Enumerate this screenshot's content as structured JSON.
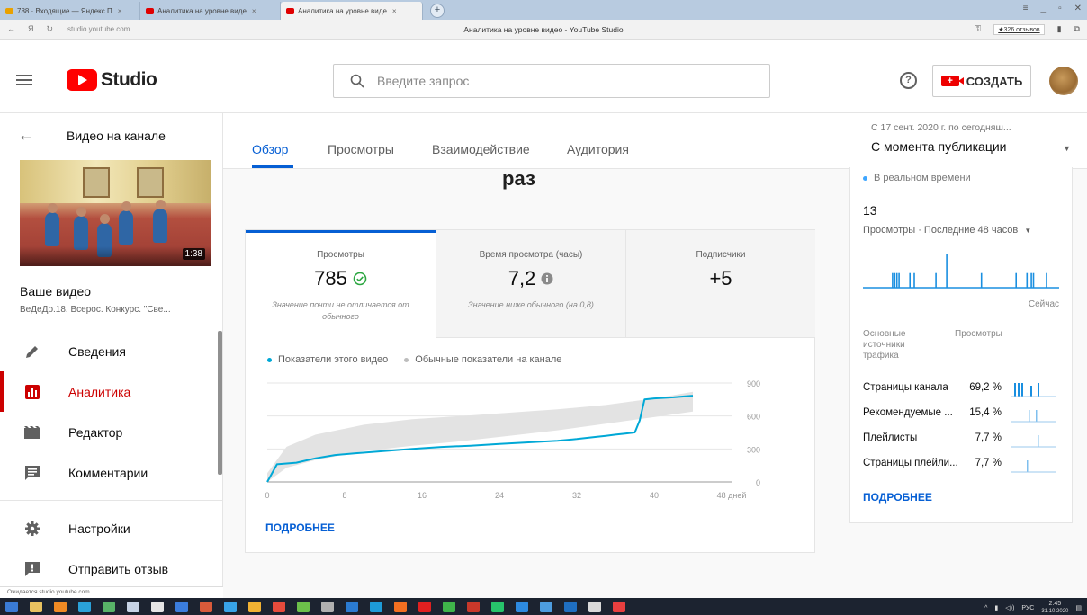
{
  "browser": {
    "tabs": [
      {
        "label": "788 · Входящие — Яндекс.П",
        "fav_color": "#e9a100"
      },
      {
        "label": "Аналитика на уровне виде",
        "fav_color": "#e00000"
      },
      {
        "label": "Аналитика на уровне виде",
        "fav_color": "#e00000"
      }
    ],
    "url": "studio.youtube.com",
    "page_title": "Аналитика на уровне видео - YouTube Studio",
    "reviews": "★326 отзывов"
  },
  "header": {
    "logo_text": "Studio",
    "search_placeholder": "Введите запрос",
    "help_glyph": "?",
    "create_label": "СОЗДАТЬ"
  },
  "sidebar": {
    "back_title": "Видео на канале",
    "duration": "1:38",
    "your_video": "Ваше видео",
    "video_subtitle": "ВеДеДо.18. Всерос. Конкурс. \"Све...",
    "items": [
      {
        "label": "Сведения",
        "icon": "pencil-icon"
      },
      {
        "label": "Аналитика",
        "icon": "analytics-icon"
      },
      {
        "label": "Редактор",
        "icon": "film-icon"
      },
      {
        "label": "Комментарии",
        "icon": "comment-icon"
      }
    ],
    "settings": "Настройки",
    "feedback": "Отправить отзыв",
    "status_url": "Ожидается studio.youtube.com"
  },
  "tabs": [
    "Обзор",
    "Просмотры",
    "Взаимодействие",
    "Аудитория"
  ],
  "date_range": {
    "line1": "С 17 сент. 2020 г. по сегодняш...",
    "line2": "С момента публикации"
  },
  "headline_fragment": "раз",
  "metrics": [
    {
      "label": "Просмотры",
      "value": "785",
      "note": "Значение почти не отличается от обычного",
      "icon": "check-circle-icon"
    },
    {
      "label": "Время просмотра (часы)",
      "value": "7,2",
      "note": "Значение ниже обычного (на 0,8)",
      "icon": "info-circle-icon"
    },
    {
      "label": "Подписчики",
      "value": "+5",
      "note": "",
      "icon": ""
    }
  ],
  "legend": {
    "this_video": "Показатели этого видео",
    "typical": "Обычные показатели на канале",
    "this_color": "#00a8d6",
    "typical_color": "#bdbdbd"
  },
  "chart_data": {
    "type": "line",
    "x_tick_labels": [
      "0",
      "8",
      "16",
      "24",
      "32",
      "40",
      "48 дней"
    ],
    "x_ticks": [
      0,
      8,
      16,
      24,
      32,
      40,
      48
    ],
    "y_ticks": [
      0,
      300,
      600,
      900
    ],
    "xlim": [
      0,
      48
    ],
    "ylim": [
      0,
      900
    ],
    "series": [
      {
        "name": "Показатели этого видео",
        "x": [
          0,
          1,
          3,
          5,
          7,
          9,
          12,
          15,
          18,
          21,
          24,
          27,
          30,
          32,
          34,
          35,
          36,
          37,
          38,
          38.5,
          39,
          40,
          42,
          44
        ],
        "y": [
          0,
          160,
          175,
          215,
          245,
          260,
          280,
          300,
          318,
          330,
          345,
          360,
          375,
          390,
          410,
          420,
          430,
          440,
          450,
          560,
          750,
          760,
          770,
          785
        ]
      }
    ],
    "typical_band": {
      "x": [
        0,
        2,
        5,
        10,
        15,
        20,
        25,
        30,
        35,
        40,
        44
      ],
      "upper": [
        80,
        320,
        430,
        520,
        570,
        600,
        630,
        660,
        700,
        760,
        820
      ],
      "lower": [
        0,
        130,
        200,
        280,
        330,
        370,
        420,
        470,
        530,
        590,
        640
      ]
    }
  },
  "more_label": "ПОДРОБНЕЕ",
  "realtime": {
    "live_label": "В реальном времени",
    "count": "13",
    "caption": "Просмотры · Последние 48 часов",
    "now_label": "Сейчас",
    "bars": [
      0,
      0,
      0,
      0,
      0,
      0,
      0,
      0,
      0,
      0,
      6,
      6,
      6,
      6,
      0,
      0,
      0,
      0,
      6,
      0,
      6,
      0,
      0,
      0,
      0,
      0,
      0,
      0,
      0,
      0,
      6,
      0,
      0,
      0,
      0,
      14,
      0,
      0,
      0,
      0,
      0,
      0,
      0,
      0,
      0,
      0,
      0,
      0,
      0,
      0,
      0,
      6,
      0,
      0,
      0,
      0,
      0,
      0,
      0,
      0,
      0,
      0,
      0,
      0,
      0,
      0,
      0,
      6,
      0,
      0,
      0,
      0,
      6,
      0,
      6,
      6,
      0,
      0,
      0,
      0,
      0,
      6,
      0
    ]
  },
  "traffic": {
    "header_source": "Основные источники трафика",
    "header_views": "Просмотры",
    "rows": [
      {
        "name": "Страницы канала",
        "pct": "69,2 %"
      },
      {
        "name": "Рекомендуемые ...",
        "pct": "15,4 %"
      },
      {
        "name": "Плейлисты",
        "pct": "7,7 %"
      },
      {
        "name": "Страницы плейли...",
        "pct": "7,7 %"
      }
    ]
  },
  "taskbar": {
    "lang": "РУС",
    "time": "2:45",
    "date": "31.10.2020"
  }
}
